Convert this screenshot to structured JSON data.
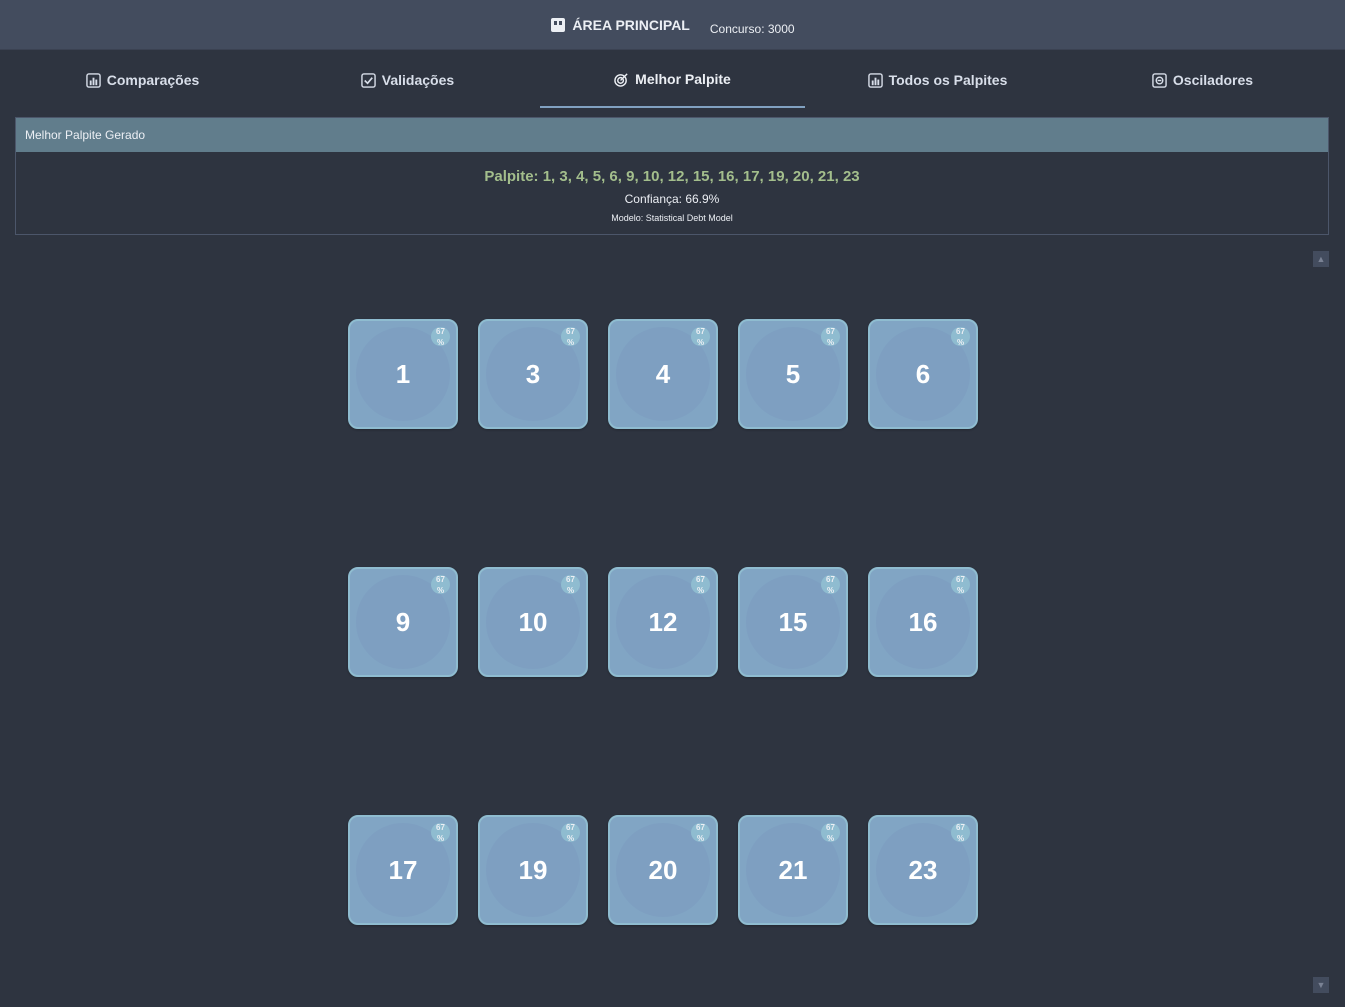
{
  "header": {
    "title": "ÁREA PRINCIPAL",
    "contest": "Concurso: 3000"
  },
  "tabs": [
    {
      "label": "Comparações",
      "icon": "bar-chart-icon"
    },
    {
      "label": "Validações",
      "icon": "checkbox-icon"
    },
    {
      "label": "Melhor Palpite",
      "icon": "target-icon",
      "active": true
    },
    {
      "label": "Todos os Palpites",
      "icon": "bar-chart-icon"
    },
    {
      "label": "Osciladores",
      "icon": "oscillator-icon"
    }
  ],
  "panel": {
    "title": "Melhor Palpite Gerado",
    "guess": "Palpite: 1, 3, 4, 5, 6, 9, 10, 12, 15, 16, 17, 19, 20, 21, 23",
    "confidence": "Confiança: 66.9%",
    "model": "Modelo: Statistical Debt Model"
  },
  "balls": [
    {
      "number": "1",
      "pct": "67",
      "unit": "%"
    },
    {
      "number": "3",
      "pct": "67",
      "unit": "%"
    },
    {
      "number": "4",
      "pct": "67",
      "unit": "%"
    },
    {
      "number": "5",
      "pct": "67",
      "unit": "%"
    },
    {
      "number": "6",
      "pct": "67",
      "unit": "%"
    },
    {
      "number": "9",
      "pct": "67",
      "unit": "%"
    },
    {
      "number": "10",
      "pct": "67",
      "unit": "%"
    },
    {
      "number": "12",
      "pct": "67",
      "unit": "%"
    },
    {
      "number": "15",
      "pct": "67",
      "unit": "%"
    },
    {
      "number": "16",
      "pct": "67",
      "unit": "%"
    },
    {
      "number": "17",
      "pct": "67",
      "unit": "%"
    },
    {
      "number": "19",
      "pct": "67",
      "unit": "%"
    },
    {
      "number": "20",
      "pct": "67",
      "unit": "%"
    },
    {
      "number": "21",
      "pct": "67",
      "unit": "%"
    },
    {
      "number": "23",
      "pct": "67",
      "unit": "%"
    }
  ],
  "colors": {
    "background": "#2e3440",
    "header": "#434c5e",
    "panel_head": "#617d8c",
    "guess_text": "#a3be8c",
    "ball": "#81a5c4",
    "ball_border": "#8fbcd0"
  }
}
